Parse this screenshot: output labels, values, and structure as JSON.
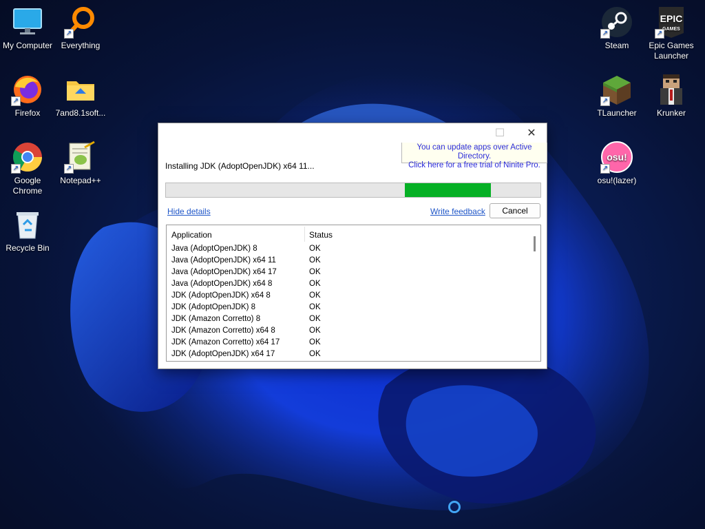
{
  "desktop": {
    "icons": [
      {
        "name": "my-computer",
        "label": "My Computer"
      },
      {
        "name": "everything",
        "label": "Everything"
      },
      {
        "name": "firefox",
        "label": "Firefox"
      },
      {
        "name": "7and8-folder",
        "label": "7and8.1soft..."
      },
      {
        "name": "google-chrome",
        "label": "Google Chrome"
      },
      {
        "name": "notepad-plus-plus",
        "label": "Notepad++"
      },
      {
        "name": "recycle-bin",
        "label": "Recycle Bin"
      },
      {
        "name": "steam",
        "label": "Steam"
      },
      {
        "name": "epic-games-launcher",
        "label": "Epic Games Launcher"
      },
      {
        "name": "tlauncher",
        "label": "TLauncher"
      },
      {
        "name": "krunker",
        "label": "Krunker"
      },
      {
        "name": "osu-lazer",
        "label": "osu!(lazer)"
      }
    ],
    "epic_logo_text": "EPIC",
    "epic_logo_sub": "GAMES",
    "osu_logo_text": "osu!"
  },
  "installer": {
    "maximize_glyph": "☐",
    "close_glyph": "✕",
    "promo_line1": "You can update apps over Active Directory.",
    "promo_line2": "Click here for a free trial of Ninite Pro.",
    "status": "Installing JDK (AdoptOpenJDK) x64 11...",
    "progress": {
      "start": 0.638,
      "end": 0.868
    },
    "hide_details": "Hide details",
    "write_feedback": "Write feedback",
    "cancel": "Cancel",
    "columns": [
      "Application",
      "Status"
    ],
    "rows": [
      {
        "app": "Java (AdoptOpenJDK) 8",
        "status": "OK"
      },
      {
        "app": "Java (AdoptOpenJDK) x64 11",
        "status": "OK"
      },
      {
        "app": "Java (AdoptOpenJDK) x64 17",
        "status": "OK"
      },
      {
        "app": "Java (AdoptOpenJDK) x64 8",
        "status": "OK"
      },
      {
        "app": "JDK (AdoptOpenJDK) x64 8",
        "status": "OK"
      },
      {
        "app": "JDK (AdoptOpenJDK) 8",
        "status": "OK"
      },
      {
        "app": "JDK (Amazon Corretto) 8",
        "status": "OK"
      },
      {
        "app": "JDK (Amazon Corretto) x64 8",
        "status": "OK"
      },
      {
        "app": "JDK (Amazon Corretto) x64 17",
        "status": "OK"
      },
      {
        "app": "JDK (AdoptOpenJDK) x64 17",
        "status": "OK"
      }
    ]
  },
  "colors": {
    "progress_green": "#06b025",
    "link_blue": "#1f56c8",
    "promo_blue": "#2b2bd8"
  }
}
